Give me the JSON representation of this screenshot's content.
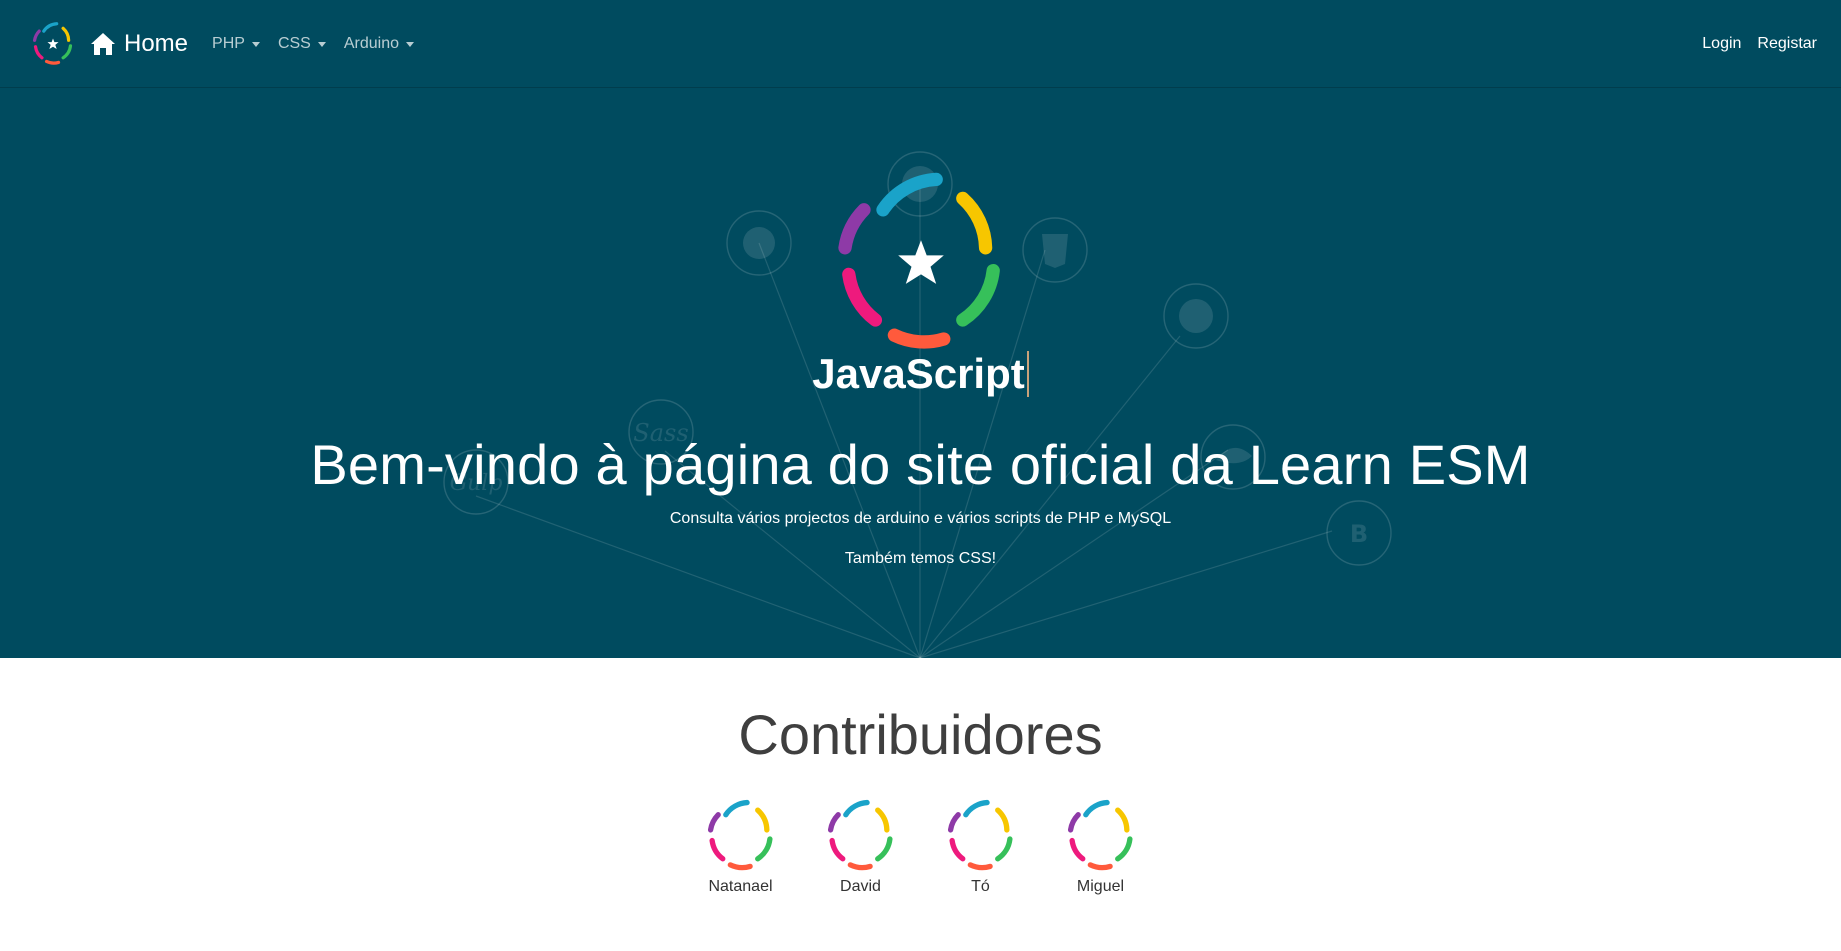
{
  "colors": {
    "navbar_bg": "#004b5f",
    "hero_bg": "#004b5f",
    "logo_purple": "#8e3aa7",
    "logo_blue": "#1aa3c9",
    "logo_yellow": "#f7c600",
    "logo_green": "#36c05a",
    "logo_orange": "#ff5a3c",
    "logo_pink": "#ee1a7d"
  },
  "navbar": {
    "brand_label": "Home",
    "logo_icon": "learn-esm-logo",
    "home_icon": "home-icon",
    "menus": [
      {
        "label": "PHP"
      },
      {
        "label": "CSS"
      },
      {
        "label": "Arduino"
      }
    ],
    "right": {
      "login": "Login",
      "register": "Registar"
    }
  },
  "hero": {
    "typed_word": "JavaScript",
    "title": "Bem-vindo à página do site oficial da Learn ESM",
    "subtitle1": "Consulta vários projectos de arduino e vários scripts de PHP e MySQL",
    "subtitle2": "Também temos CSS!",
    "background_icons": [
      "wordpress-icon",
      "circle-icon",
      "html5-icon",
      "github-icon",
      "sass-icon",
      "gulp-icon",
      "mysql-icon",
      "bootstrap-icon"
    ]
  },
  "contributors": {
    "title": "Contribuidores",
    "people": [
      {
        "name": "Natanael"
      },
      {
        "name": "David"
      },
      {
        "name": "Tó"
      },
      {
        "name": "Miguel"
      }
    ]
  }
}
